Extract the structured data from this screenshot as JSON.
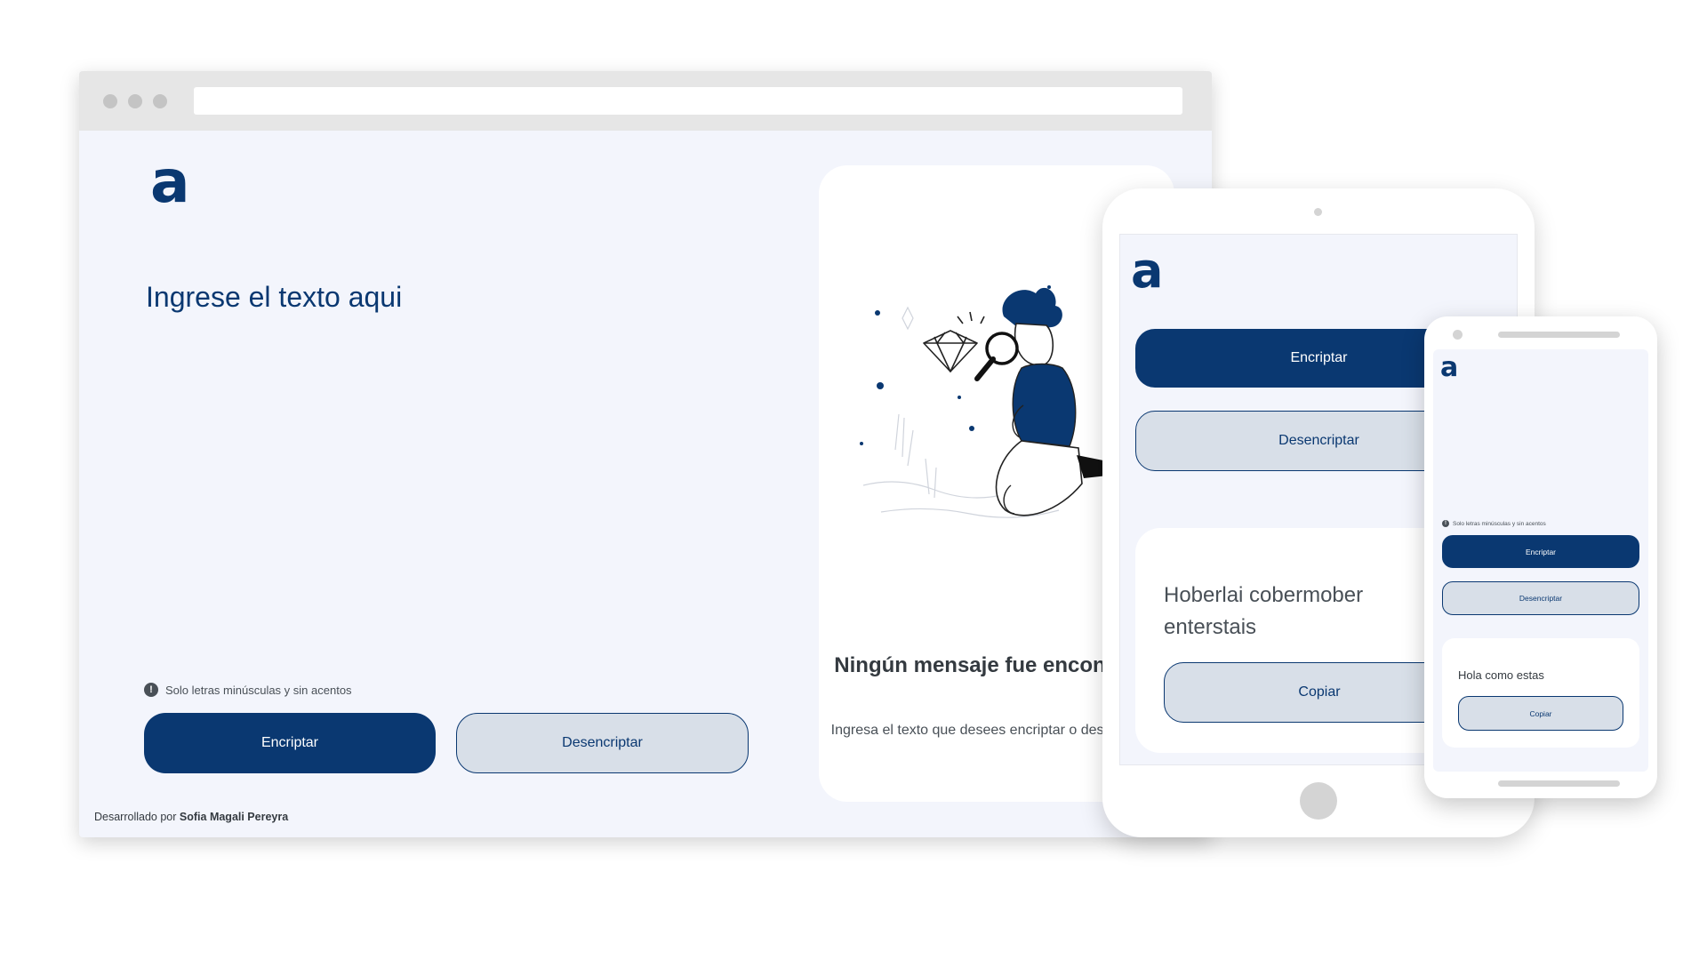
{
  "colors": {
    "brand": "#0a3871",
    "background": "#f3f5fc",
    "secondary_button": "#d8dfe8",
    "text_dark": "#343a40",
    "text_muted": "#495057"
  },
  "logo": {
    "glyph": "a",
    "icon": "alura-logo-icon"
  },
  "desktop": {
    "heading": "Ingrese el texto aqui",
    "hint": "Solo letras minúsculas y sin acentos",
    "hint_icon_glyph": "!",
    "encrypt_label": "Encriptar",
    "decrypt_label": "Desencriptar",
    "footer_prefix": "Desarrollado por",
    "footer_author": "Sofia Magali Pereyra",
    "result": {
      "illustration": "person-with-magnifier-illustration",
      "empty_title": "Ningún mensaje fue encontrado",
      "empty_subtitle": "Ingresa el texto que desees encriptar o desencriptar."
    }
  },
  "tablet": {
    "encrypt_label": "Encriptar",
    "decrypt_label": "Desencriptar",
    "result_text": "Hoberlai cobermober enterstais",
    "copy_label": "Copiar"
  },
  "phone": {
    "hint": "Solo letras minúsculas y sin acentos",
    "hint_icon_glyph": "!",
    "encrypt_label": "Encriptar",
    "decrypt_label": "Desencriptar",
    "result_text": "Hola como estas",
    "copy_label": "Copiar"
  }
}
